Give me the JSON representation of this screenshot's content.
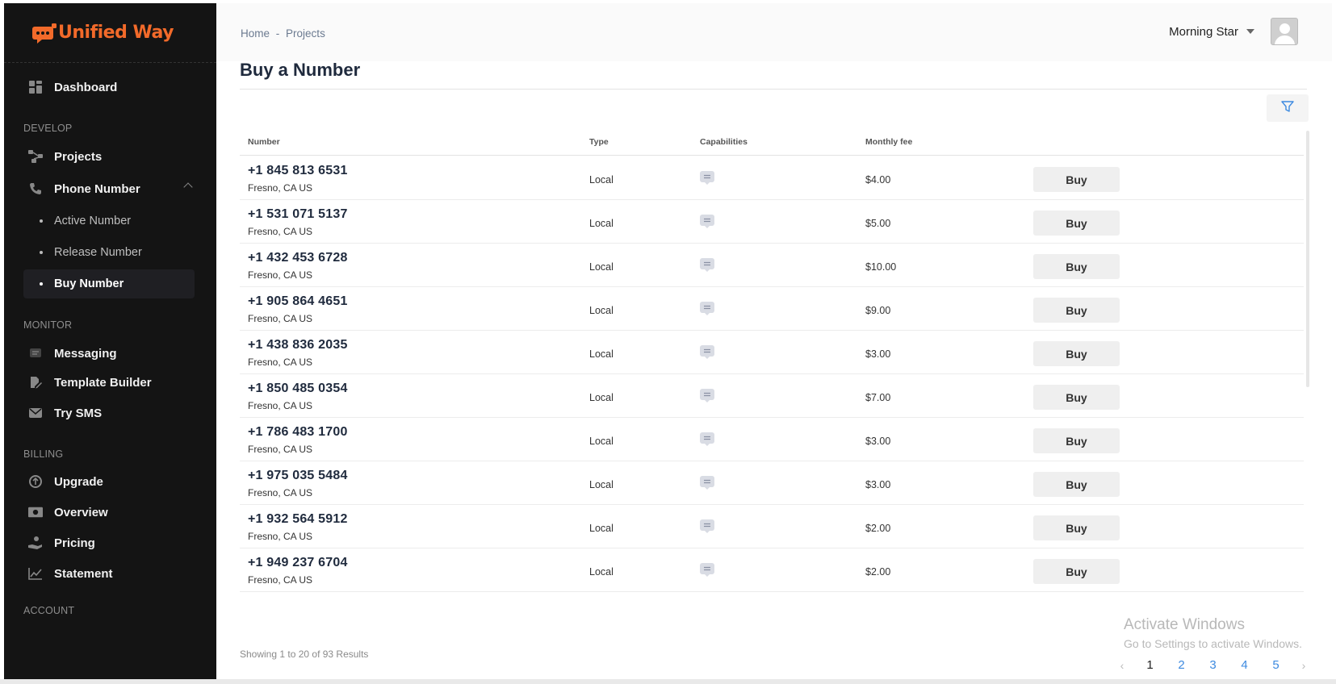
{
  "app": {
    "logo_text": "Unified Way"
  },
  "sidebar": {
    "dashboard": "Dashboard",
    "section_develop": "DEVELOP",
    "projects": "Projects",
    "phone_number": "Phone Number",
    "active_number": "Active Number",
    "release_number": "Release Number",
    "buy_number": "Buy Number",
    "section_monitor": "MONITOR",
    "messaging": "Messaging",
    "template_builder": "Template Builder",
    "try_sms": "Try SMS",
    "section_billing": "BILLING",
    "upgrade": "Upgrade",
    "overview": "Overview",
    "pricing": "Pricing",
    "statement": "Statement",
    "section_account": "ACCOUNT"
  },
  "header": {
    "breadcrumb_home": "Home",
    "breadcrumb_sep": "-",
    "breadcrumb_projects": "Projects",
    "user_name": "Morning Star"
  },
  "page": {
    "title": "Buy a Number"
  },
  "table": {
    "columns": {
      "number": "Number",
      "type": "Type",
      "capabilities": "Capabilities",
      "monthly_fee": "Monthly fee"
    },
    "buy_label": "Buy",
    "rows": [
      {
        "number": "+1 845 813 6531",
        "location": "Fresno, CA US",
        "type": "Local",
        "fee": "$4.00"
      },
      {
        "number": "+1 531 071 5137",
        "location": "Fresno, CA US",
        "type": "Local",
        "fee": "$5.00"
      },
      {
        "number": "+1 432 453 6728",
        "location": "Fresno, CA US",
        "type": "Local",
        "fee": "$10.00"
      },
      {
        "number": "+1 905 864 4651",
        "location": "Fresno, CA US",
        "type": "Local",
        "fee": "$9.00"
      },
      {
        "number": "+1 438 836 2035",
        "location": "Fresno, CA US",
        "type": "Local",
        "fee": "$3.00"
      },
      {
        "number": "+1 850 485 0354",
        "location": "Fresno, CA US",
        "type": "Local",
        "fee": "$7.00"
      },
      {
        "number": "+1 786 483 1700",
        "location": "Fresno, CA US",
        "type": "Local",
        "fee": "$3.00"
      },
      {
        "number": "+1 975 035 5484",
        "location": "Fresno, CA US",
        "type": "Local",
        "fee": "$3.00"
      },
      {
        "number": "+1 932 564 5912",
        "location": "Fresno, CA US",
        "type": "Local",
        "fee": "$2.00"
      },
      {
        "number": "+1 949 237 6704",
        "location": "Fresno, CA US",
        "type": "Local",
        "fee": "$2.00"
      }
    ]
  },
  "footer": {
    "results_text": "Showing 1 to 20 of 93 Results",
    "pages": [
      "1",
      "2",
      "3",
      "4",
      "5"
    ],
    "current_page": "1",
    "prev": "‹",
    "next": "›"
  },
  "watermark": {
    "line1": "Activate Windows",
    "line2": "Go to Settings to activate Windows."
  },
  "colors": {
    "sidebar_bg": "#141414",
    "brand": "#f26a2a",
    "link": "#3d8ae0"
  }
}
